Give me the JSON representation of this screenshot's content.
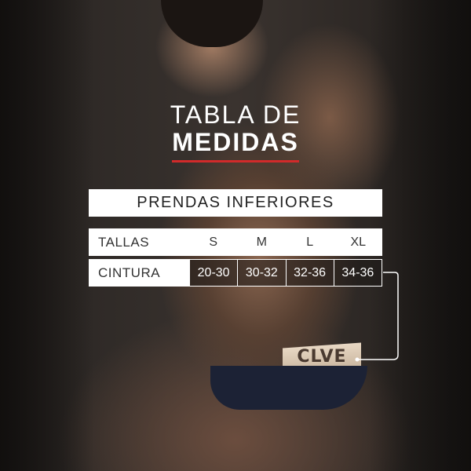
{
  "colors": {
    "accent_line": "#d12a2a",
    "panel": "#ffffff"
  },
  "heading": {
    "line1": "TABLA DE",
    "line2": "MEDIDAS"
  },
  "table": {
    "title": "PRENDAS INFERIORES",
    "size_label": "TALLAS",
    "sizes": [
      "S",
      "M",
      "L",
      "XL"
    ],
    "measure_label": "CINTURA",
    "waist": [
      "20-30",
      "30-32",
      "32-36",
      "34-36"
    ]
  },
  "band_logo": "CLVE"
}
